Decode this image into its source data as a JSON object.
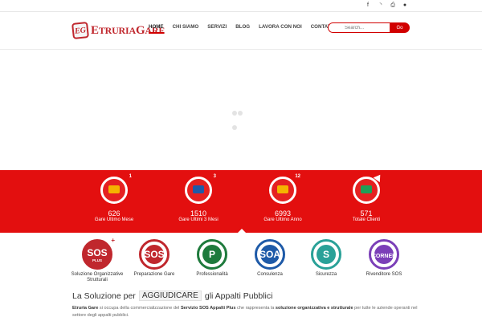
{
  "topbar": {
    "icons": [
      {
        "name": "facebook-icon",
        "glyph": "f"
      },
      {
        "name": "rss-icon",
        "glyph": "◝"
      },
      {
        "name": "print-icon",
        "glyph": "⎙"
      },
      {
        "name": "user-icon",
        "glyph": "●"
      }
    ]
  },
  "header": {
    "logo_mark": "EG",
    "logo_text_first": "E",
    "logo_text_mid": "TRURIA",
    "logo_text_second": "G",
    "logo_text_end": "ARE",
    "nav": [
      "HOME",
      "CHI SIAMO",
      "SERVIZI",
      "BLOG",
      "LAVORA CON NOI",
      "CONTATTI"
    ],
    "active_nav": "HOME",
    "search_placeholder": "Search...",
    "search_button": "Go"
  },
  "stats": [
    {
      "value": "626",
      "label": "Gare Ultimo Mese",
      "badge": "1",
      "inner_color": "#f4b400"
    },
    {
      "value": "1510",
      "label": "Gare Ultimi 3 Mesi",
      "badge": "3",
      "inner_color": "#1e5aa8"
    },
    {
      "value": "6993",
      "label": "Gare Ultimo Anno",
      "badge": "12",
      "inner_color": "#f4b400"
    },
    {
      "value": "571",
      "label": "Totale Clienti",
      "badge": "",
      "inner_color": "#1f9e57"
    }
  ],
  "services": [
    {
      "title": "SOS",
      "sub": "PLUS",
      "plus": "+",
      "name": "Soluzione Organizzative Strutturali",
      "color": "#c0272d",
      "style": "filled"
    },
    {
      "title": "SOS",
      "sub": "",
      "plus": "",
      "name": "Preparazione Gare",
      "color": "#c0272d",
      "style": "filled"
    },
    {
      "title": "P",
      "sub": "",
      "plus": "",
      "name": "Professionalità",
      "color": "#1e7a3c",
      "style": "filled"
    },
    {
      "title": "SOA",
      "sub": "",
      "plus": "",
      "name": "Consulenza",
      "color": "#1e5aa8",
      "style": "filled"
    },
    {
      "title": "S",
      "sub": "",
      "plus": "",
      "name": "Sicurezza",
      "color": "#2aa198",
      "style": "filled"
    },
    {
      "title": "CORNER",
      "sub": "",
      "plus": "",
      "name": "Rivenditore SOS",
      "color": "#7b3fb8",
      "style": "filled"
    }
  ],
  "intro": {
    "headline_before": "La Soluzione per",
    "headline_highlight": "AGGIUDICARE",
    "headline_after": "gli Appalti Pubblici",
    "desc_brand": "Etruria Gare",
    "desc_part1": " si occupa della commercializzazione del ",
    "desc_service": "Servizio SOS Appalti Plus",
    "desc_part2": " che rappresenta la ",
    "desc_solution": "soluzione organizzativa e strutturale",
    "desc_part3": " per tutte le aziende operanti nel settore degli appalti pubblici."
  },
  "colors": {
    "brand_red": "#e30f0f",
    "logo_red": "#c0272d"
  }
}
